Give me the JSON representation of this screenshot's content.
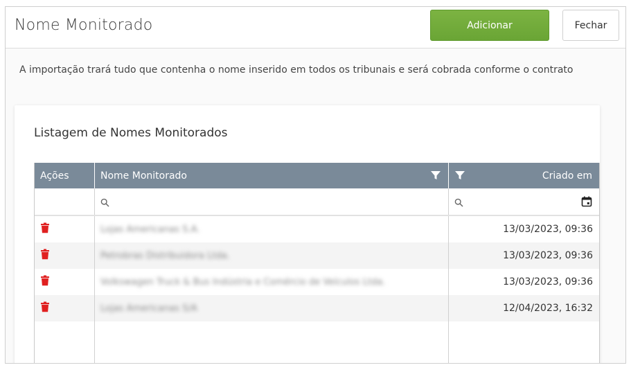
{
  "header": {
    "title": "Nome Monitorado",
    "add_label": "Adicionar",
    "close_label": "Fechar"
  },
  "info_text": "A importação trará tudo que contenha o nome inserido em todos os tribunais e será cobrada conforme o contrato",
  "card": {
    "title": "Listagem de Nomes Monitorados"
  },
  "grid": {
    "columns": {
      "actions": "Ações",
      "name": "Nome Monitorado",
      "created": "Criado em"
    },
    "filters": {
      "name_placeholder": "",
      "created_placeholder": ""
    },
    "rows": [
      {
        "name": "Lojas Americanas S.A.",
        "created": "13/03/2023, 09:36"
      },
      {
        "name": "Petrobras Distribuidora Ltda.",
        "created": "13/03/2023, 09:36"
      },
      {
        "name": "Volkswagen Truck & Bus Indústria e Comércio de Veículos Ltda.",
        "created": "13/03/2023, 09:36"
      },
      {
        "name": "Lojas Americanas S/A",
        "created": "12/04/2023, 16:32"
      }
    ]
  },
  "colors": {
    "accent_green": "#6aa535",
    "header_gray": "#7a8a99",
    "trash_red": "#e02020"
  },
  "icons": {
    "filter": "filter-icon",
    "search": "search-icon",
    "calendar": "calendar-icon",
    "delete": "trash-icon"
  }
}
